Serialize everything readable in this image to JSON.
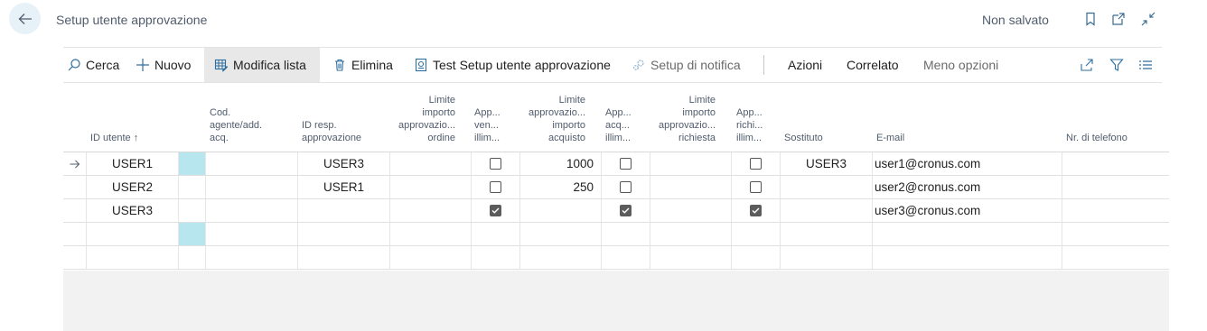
{
  "header": {
    "title": "Setup utente approvazione",
    "status": "Non salvato"
  },
  "toolbar": {
    "search": "Cerca",
    "new": "Nuovo",
    "edit_list": "Modifica lista",
    "delete": "Elimina",
    "test_setup": "Test Setup utente approvazione",
    "notification_setup": "Setup di notifica",
    "actions": "Azioni",
    "related": "Correlato",
    "fewer_options": "Meno opzioni"
  },
  "columns": {
    "user_id": "ID utente ↑",
    "salesperson": "Cod.\nagente/add.\nacq.",
    "approver_id": "ID resp.\napprovazione",
    "order_limit": "Limite\nimporto\napprovazio...\nordine",
    "sales_unlimited": "App...\nven...\nillim...",
    "purchase_limit": "Limite\napprovazio...\nimporto\nacquisto",
    "purchase_unlimited": "App...\nacq...\nillim...",
    "request_limit": "Limite\nimporto\napprovazio...\nrichiesta",
    "request_unlimited": "App...\nrichi...\nillim...",
    "substitute": "Sostituto",
    "email": "E-mail",
    "phone": "Nr. di telefono"
  },
  "rows": [
    {
      "user_id": "USER1",
      "approver_id": "USER3",
      "sales_unlimited": false,
      "purchase_limit": "1000",
      "purchase_unlimited": false,
      "request_unlimited": false,
      "substitute": "USER3",
      "email": "user1@cronus.com"
    },
    {
      "user_id": "USER2",
      "approver_id": "USER1",
      "sales_unlimited": false,
      "purchase_limit": "250",
      "purchase_unlimited": false,
      "request_unlimited": false,
      "substitute": "",
      "email": "user2@cronus.com"
    },
    {
      "user_id": "USER3",
      "approver_id": "",
      "sales_unlimited": true,
      "purchase_limit": "",
      "purchase_unlimited": true,
      "request_unlimited": true,
      "substitute": "",
      "email": "user3@cronus.com"
    }
  ]
}
